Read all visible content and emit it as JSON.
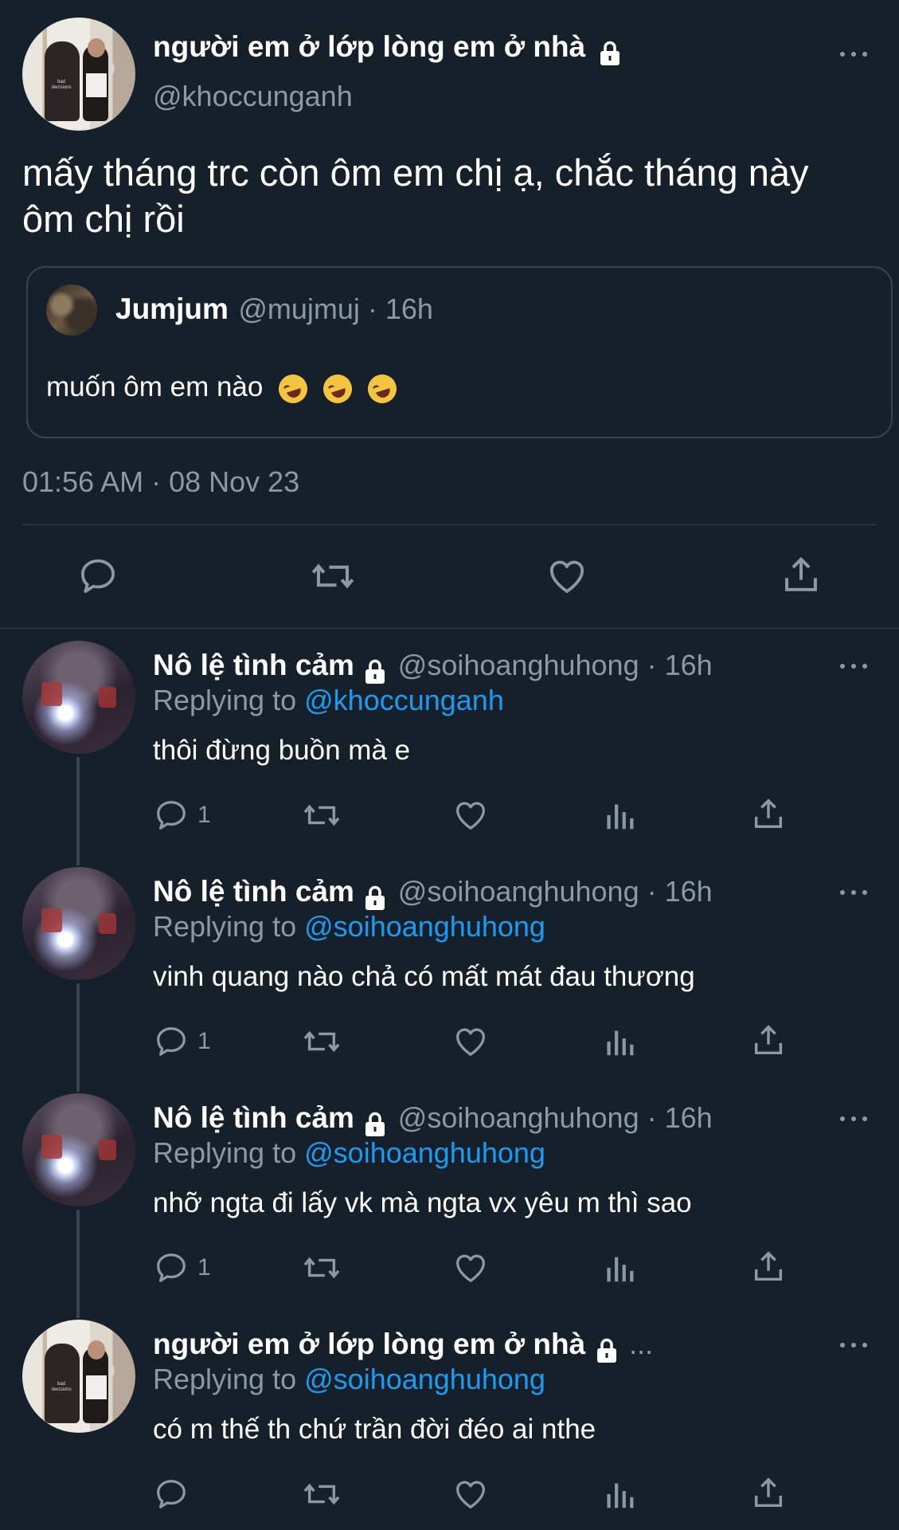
{
  "main_tweet": {
    "display_name": "người em ở lớp lòng em ở nhà",
    "handle": "@khoccunganh",
    "text_line1": "mấy tháng trc còn ôm em chị ạ, chắc tháng này",
    "text_line2": "ôm chị rồi",
    "avatar_sign_line1": "bad",
    "avatar_sign_line2": "decisions",
    "timestamp": "01:56 AM · 08 Nov 23",
    "quoted": {
      "display_name": "Jumjum",
      "handle": "@mujmuj · 16h",
      "text": "muốn ôm em nào"
    }
  },
  "replies": [
    {
      "display_name": "Nô lệ tình cảm",
      "handle_time": "@soihoanghuhong · 16h",
      "replying_prefix": "Replying to",
      "replying_to": "@khoccunganh",
      "text": "thôi đừng buồn mà e",
      "reply_count": "1"
    },
    {
      "display_name": "Nô lệ tình cảm",
      "handle_time": "@soihoanghuhong · 16h",
      "replying_prefix": "Replying to",
      "replying_to": "@soihoanghuhong",
      "text": "vinh quang nào chả có mất mát đau thương",
      "reply_count": "1"
    },
    {
      "display_name": "Nô lệ tình cảm",
      "handle_time": "@soihoanghuhong · 16h",
      "replying_prefix": "Replying to",
      "replying_to": "@soihoanghuhong",
      "text": "nhỡ ngta đi lấy vk mà ngta vx yêu m thì sao",
      "reply_count": "1"
    },
    {
      "display_name": "người em ở lớp lòng em ở nhà",
      "handle_time": "...",
      "replying_prefix": "Replying to",
      "replying_to": "@soihoanghuhong",
      "text": "có m thế th chứ trần đời đéo ai nthe",
      "reply_count": ""
    }
  ],
  "colors": {
    "background": "#15202b",
    "text": "#ffffff",
    "secondary": "#8b98a5",
    "link": "#1d9bf0",
    "divider": "#38444d"
  },
  "icons": {
    "reply": "reply-icon",
    "retweet": "retweet-icon",
    "like": "heart-icon",
    "share": "share-icon",
    "views": "analytics-icon",
    "more": "more-icon",
    "lock": "lock-icon"
  }
}
